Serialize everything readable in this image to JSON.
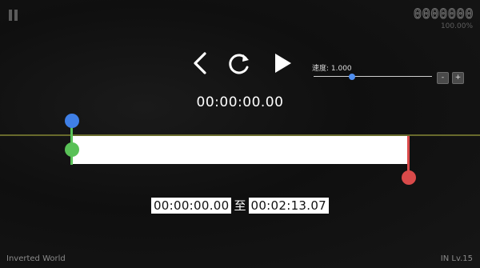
{
  "header": {
    "score": "0000000",
    "accuracy": "100.00%"
  },
  "controls": {
    "prev_icon": "chevron-left-icon",
    "reload_icon": "reload-icon",
    "play_icon": "play-icon"
  },
  "speed": {
    "label": "速度: 1.000",
    "value": 1.0,
    "minus_label": "-",
    "plus_label": "+"
  },
  "playback": {
    "current_time": "00:00:00.00"
  },
  "range": {
    "start_time": "00:00:00.00",
    "separator": "至",
    "end_time": "00:02:13.07"
  },
  "footer": {
    "song_title": "Inverted World",
    "level": "IN Lv.15"
  },
  "colors": {
    "start_marker": "#59c157",
    "end_marker": "#d94a4a",
    "cursor_marker": "#3f7fe6",
    "speed_thumb": "#4f8ef0",
    "timeline_line": "#686a2c"
  }
}
